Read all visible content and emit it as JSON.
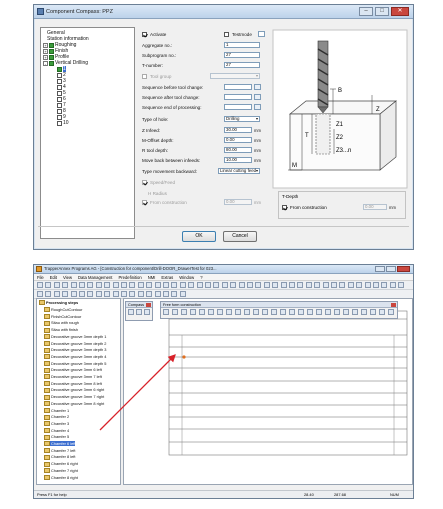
{
  "dialog": {
    "title": "Component Compass: PPZ",
    "tree": {
      "items": [
        {
          "label": "General",
          "indent": 0
        },
        {
          "label": "Station information",
          "indent": 0
        },
        {
          "label": "Roughing",
          "indent": 0
        },
        {
          "label": "Finish",
          "indent": 0
        },
        {
          "label": "Profile",
          "indent": 0
        },
        {
          "label": "Vertical Drilling",
          "indent": 0
        }
      ],
      "numbered": [
        "1",
        "2",
        "3",
        "4",
        "5",
        "6",
        "7",
        "8",
        "9",
        "10"
      ]
    },
    "form": {
      "activate_label": "Activate",
      "testmode_label": "Testmode",
      "aggregate_label": "Aggregate no.:",
      "aggregate_value": "1",
      "subprogram_label": "Subprogram no.:",
      "subprogram_value": "27",
      "t_number_label": "T-number:",
      "t_number_value": "27",
      "tool_group_label": "Tool group",
      "seq_before_label": "Sequence before tool change:",
      "seq_after_label": "Sequence after tool change:",
      "seq_processing_label": "Sequence end of processing:",
      "type_of_hole_label": "Type of hole:",
      "type_of_hole_value": "Drilling",
      "z_infeed_label": "Z Infeed:",
      "z_infeed_value": "30.00",
      "m_offset_label": "M-Offset depth:",
      "m_offset_value": "0.00",
      "r_tool_depth_label": "R tool depth:",
      "r_tool_depth_value": "80.00",
      "move_back_label": "Move back between infeeds:",
      "move_back_value": "10.00",
      "type_movement_label": "Type movement backward:",
      "type_movement_value": "Linear cutting feed",
      "speed_feed_label": "Speed/Feed",
      "h_radius_label": "H Radius",
      "from_construction_label": "From construction",
      "from_construction_value": "0.00",
      "unit_mm": "mm",
      "t_depth_label": "T-Depth",
      "t_from_construction_label": "From construction",
      "t_from_construction_value": "0.00"
    },
    "diagram_labels": [
      "B",
      "Z",
      "Z1",
      "Z2",
      "Z3...n",
      "T",
      "M"
    ],
    "buttons": {
      "ok": "OK",
      "cancel": "Cancel"
    }
  },
  "app": {
    "title": "TrapperAnnex Programs AG - [Construction for component/Drill-DOOR_DrawerTest for 023...",
    "menu": [
      "File",
      "Edit",
      "View",
      "Data Management",
      "Predefinition",
      "NMI",
      "Extras",
      "Window",
      "?"
    ],
    "tree_root": "Processing steps",
    "tree_items": [
      "RoughCutContour",
      "FinishCutContour",
      "Sitau with rough",
      "Sitau with finish",
      "Decorative groove 3mm depth 1",
      "Decorative groove 3mm depth 2",
      "Decorative groove 3mm depth 3",
      "Decorative groove 3mm depth 4",
      "Decorative groove 3mm depth 5",
      "Decorative groove 3mm 6 left",
      "Decorative groove 3mm 7 left",
      "Decorative groove 3mm 8 left",
      "Decorative groove 3mm 6 right",
      "Decorative groove 3mm 7 right",
      "Decorative groove 3mm 8 right",
      "Chamfer 1",
      "Chamfer 2",
      "Chamfer 3",
      "Chamfer 4",
      "Chamfer 5",
      "Chamfer 6 left",
      "Chamfer 7 left",
      "Chamfer 8 left",
      "Chamfer 6 right",
      "Chamfer 7 right",
      "Chamfer 8 right"
    ],
    "selected_index": 20,
    "compass_palette_title": "Compass",
    "freeform_palette_title": "Free form construction",
    "status_left": "Press F1 for help",
    "status_coords": [
      "28.40",
      "287.68"
    ],
    "status_right": "NUM"
  }
}
